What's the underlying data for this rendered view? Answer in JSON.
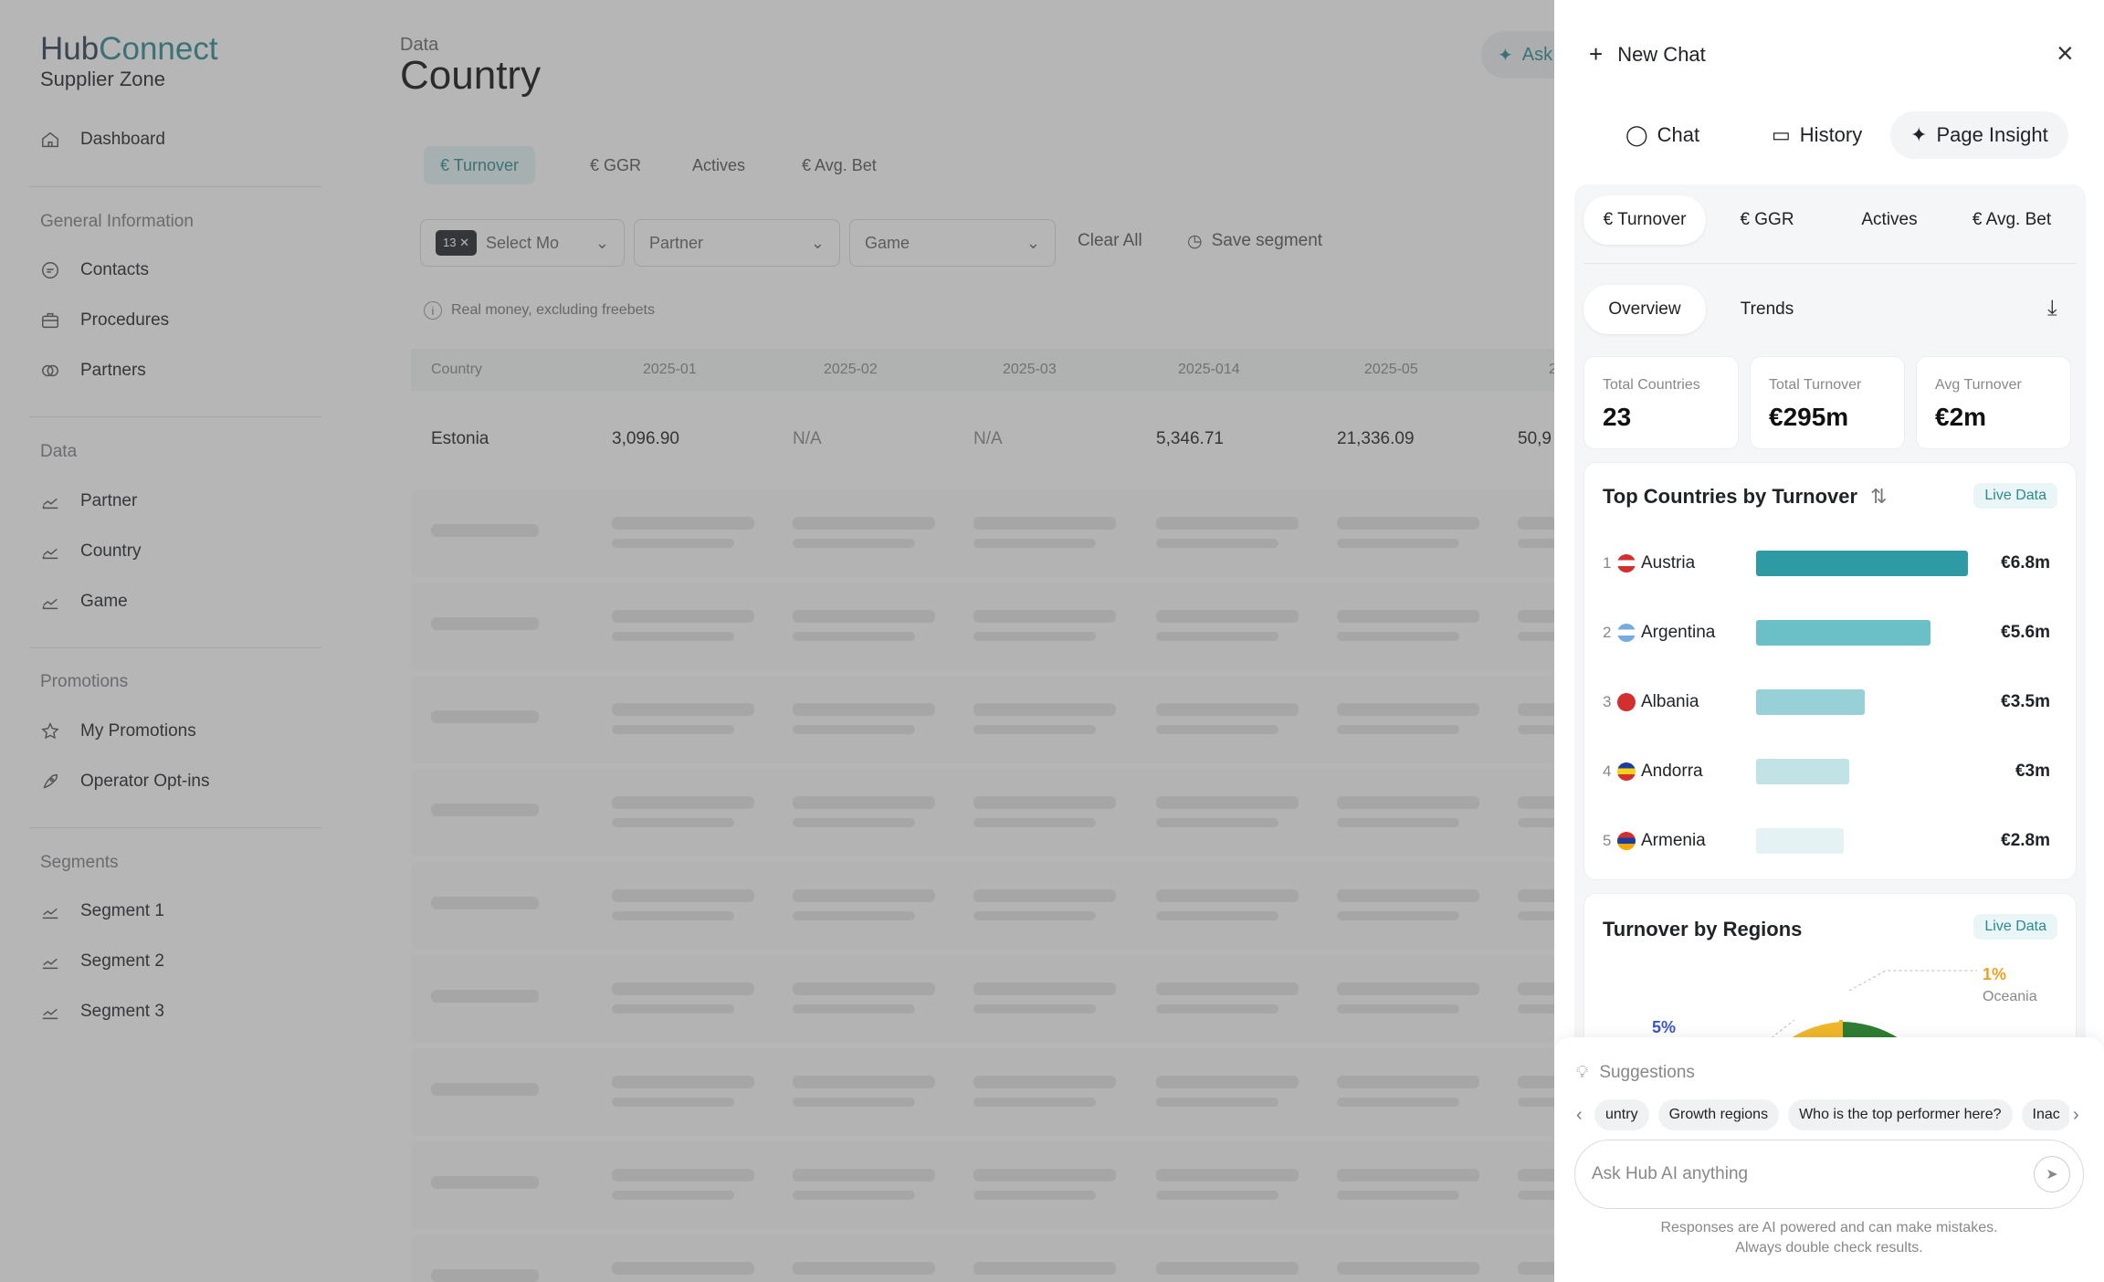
{
  "brand": {
    "logo_a": "Hub",
    "logo_b": "Connect",
    "subtitle": "Supplier Zone"
  },
  "sidebar": {
    "dashboard": "Dashboard",
    "sections": [
      {
        "title": "General Information",
        "items": [
          "Contacts",
          "Procedures",
          "Partners"
        ]
      },
      {
        "title": "Data",
        "items": [
          "Partner",
          "Country",
          "Game"
        ]
      },
      {
        "title": "Promotions",
        "items": [
          "My Promotions",
          "Operator Opt-ins"
        ]
      },
      {
        "title": "Segments",
        "items": [
          "Segment 1",
          "Segment 2",
          "Segment 3"
        ]
      }
    ]
  },
  "main": {
    "breadcrumb": "Data",
    "title": "Country",
    "ask_label": "Ask",
    "tabs": [
      "€ Turnover",
      "€ GGR",
      "Actives",
      "€ Avg. Bet"
    ],
    "filters": {
      "month_badge": "13",
      "month_placeholder": "Select Mo",
      "partner": "Partner",
      "game": "Game",
      "clear_all": "Clear All",
      "save_segment": "Save segment"
    },
    "note": "Real money, excluding freebets",
    "table": {
      "headers": [
        "Country",
        "2025-01",
        "2025-02",
        "2025-03",
        "2025-014",
        "2025-05",
        "2"
      ],
      "row": [
        "Estonia",
        "3,096.90",
        "N/A",
        "N/A",
        "5,346.71",
        "21,336.09",
        "50,9"
      ]
    }
  },
  "panel": {
    "new_chat": "New Chat",
    "tabs": [
      "Chat",
      "History",
      "Page Insight"
    ],
    "metric_tabs": [
      "€ Turnover",
      "€ GGR",
      "Actives",
      "€ Avg. Bet"
    ],
    "view_tabs": [
      "Overview",
      "Trends"
    ],
    "stats": [
      {
        "label": "Total Countries",
        "value": "23"
      },
      {
        "label": "Total Turnover",
        "value": "€295m"
      },
      {
        "label": "Avg Turnover",
        "value": "€2m"
      }
    ],
    "top_card": {
      "title": "Top Countries by Turnover",
      "live": "Live Data",
      "rows": [
        {
          "rank": "1",
          "country": "Austria",
          "value": "€6.8m",
          "amount": 6.8,
          "color": "#2e9aa3"
        },
        {
          "rank": "2",
          "country": "Argentina",
          "value": "€5.6m",
          "amount": 5.6,
          "color": "#6bbfc6"
        },
        {
          "rank": "3",
          "country": "Albania",
          "value": "€3.5m",
          "amount": 3.5,
          "color": "#97d0d6"
        },
        {
          "rank": "4",
          "country": "Andorra",
          "value": "€3m",
          "amount": 3.0,
          "color": "#c1e3e6"
        },
        {
          "rank": "5",
          "country": "Armenia",
          "value": "€2.8m",
          "amount": 2.8,
          "color": "#e4f2f3"
        }
      ]
    },
    "regions_card": {
      "title": "Turnover by Regions",
      "live": "Live Data",
      "pct_oceania": "1%",
      "oceania": "Oceania",
      "pct_other": "5%"
    },
    "suggestions": {
      "title": "Suggestions",
      "chips": [
        "untry",
        "Growth regions",
        "Who is the top performer here?",
        "Inac"
      ]
    },
    "input_placeholder": "Ask Hub AI anything",
    "disclaimer_1": "Responses are AI powered and can make mistakes.",
    "disclaimer_2": "Always double check results."
  }
}
